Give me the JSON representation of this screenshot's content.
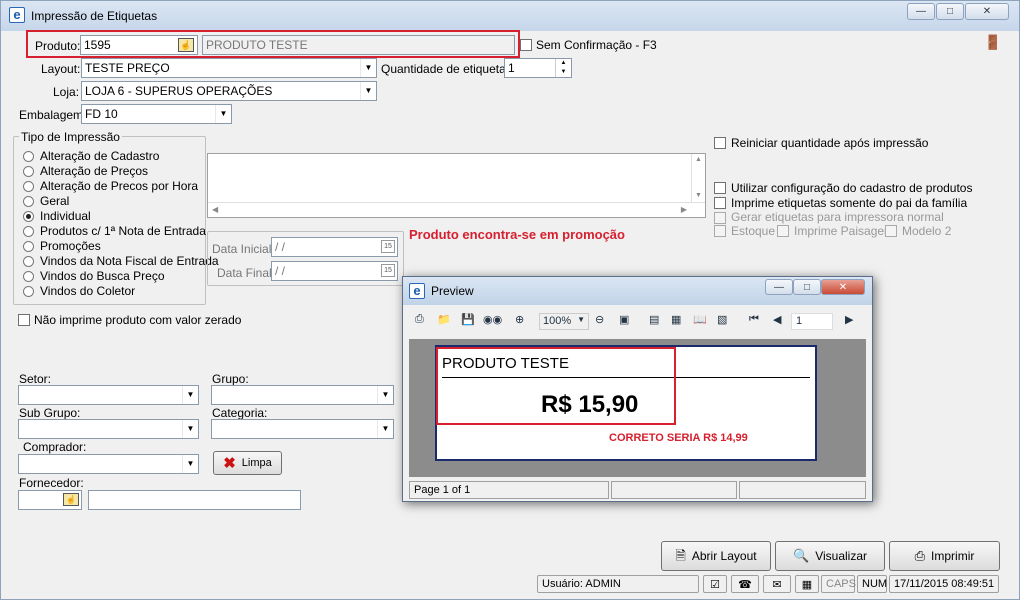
{
  "window": {
    "title": "Impressão de Etiquetas"
  },
  "form": {
    "produto_label": "Produto:",
    "produto_code": "1595",
    "produto_name": "PRODUTO TESTE",
    "sem_confirmacao": "Sem Confirmação - F3",
    "layout_label": "Layout:",
    "layout_value": "TESTE PREÇO",
    "quantidade_label": "Quantidade de etiquetas:",
    "quantidade_value": "1",
    "loja_label": "Loja:",
    "loja_value": "LOJA 6 - SUPERUS OPERAÇÕES",
    "embalagem_label": "Embalagem:",
    "embalagem_value": "FD   10"
  },
  "tipo": {
    "title": "Tipo de Impressão",
    "options": [
      "Alteração de Cadastro",
      "Alteração de Preços",
      "Alteração de Precos por Hora",
      "Geral",
      "Individual",
      "Produtos c/ 1ª Nota de Entrada",
      "Promoções",
      "Vindos da Nota Fiscal de Entrada",
      "Vindos do Busca Preço",
      "Vindos do Coletor"
    ],
    "selected": "Individual"
  },
  "promo_message": "Produto encontra-se em promoção",
  "dates": {
    "inicial_label": "Data Inicial:",
    "inicial_value": " / /",
    "final_label": "Data Final:",
    "final_value": " / /",
    "cal_glyph": "15"
  },
  "options_right": {
    "reiniciar": "Reiniciar quantidade após impressão",
    "utilizar": "Utilizar configuração do cadastro de produtos",
    "imprime_pai": "Imprime etiquetas somente do pai da família",
    "gerar": "Gerar etiquetas para impressora normal",
    "estoque": "Estoque",
    "paisagem": "Imprime Paisagem",
    "modelo2": "Modelo 2"
  },
  "nao_imprime": "Não imprime produto com valor zerado",
  "filters": {
    "setor": "Setor:",
    "grupo": "Grupo:",
    "subgrupo": "Sub Grupo:",
    "categoria": "Categoria:",
    "comprador": "Comprador:",
    "fornecedor": "Fornecedor:",
    "limpa": "Limpa"
  },
  "buttons": {
    "abrir_layout": "Abrir Layout",
    "visualizar": "Visualizar",
    "imprimir": "Imprimir"
  },
  "status": {
    "usuario": "Usuário: ADMIN",
    "caps": "CAPS",
    "num": "NUM",
    "datetime": "17/11/2015 08:49:51"
  },
  "preview": {
    "title": "Preview",
    "zoom": "100%",
    "page_input": "1",
    "label_product": "PRODUTO TESTE",
    "label_price": "R$ 15,90",
    "correction": "CORRETO SERIA R$ 14,99",
    "page_status": "Page 1 of 1"
  },
  "colors": {
    "highlight_red": "#d6202f",
    "promo_red": "#d6202f",
    "label_border": "#1a2a6c"
  }
}
